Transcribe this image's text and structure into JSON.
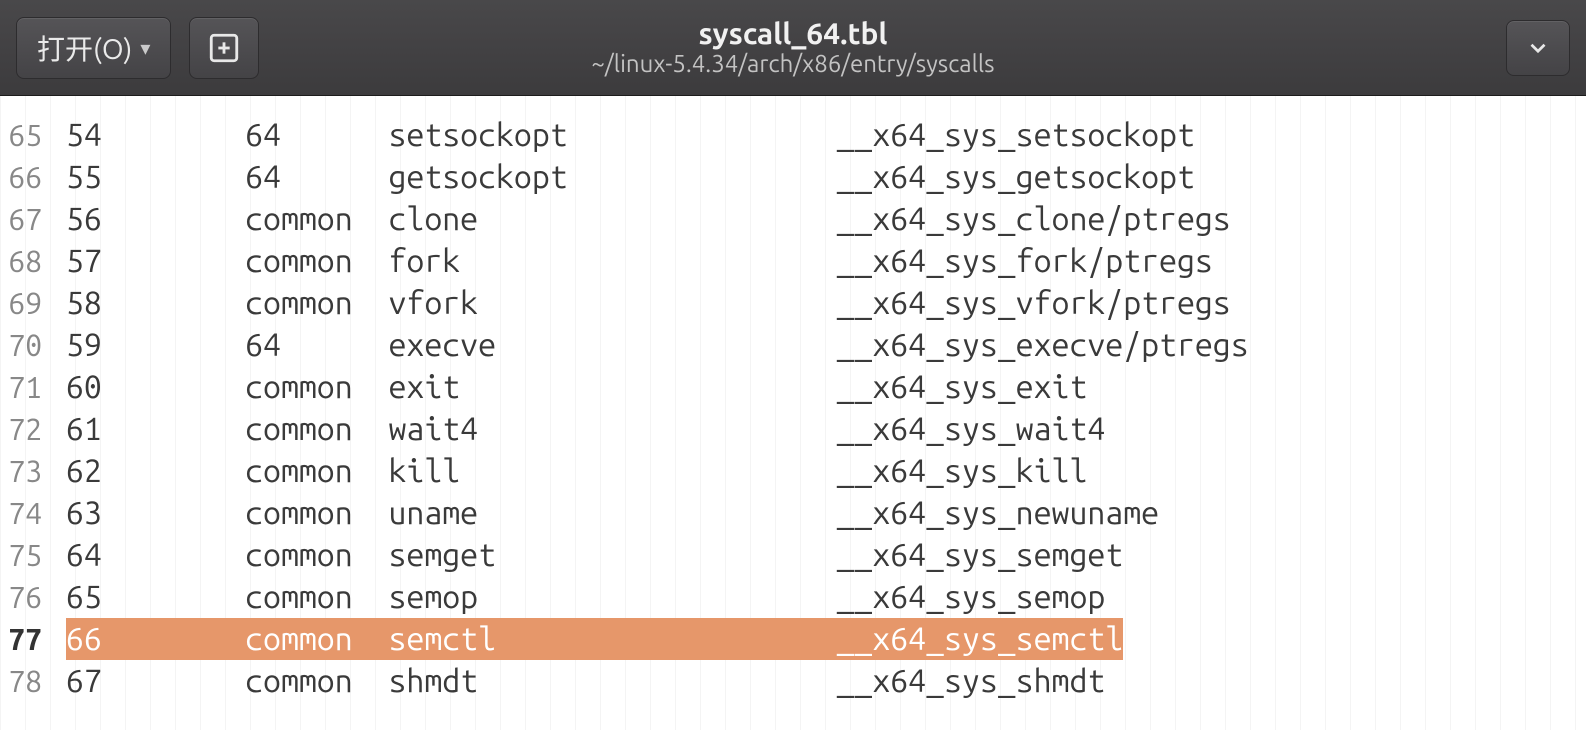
{
  "header": {
    "open_label": "打开(O)",
    "file_title": "syscall_64.tbl",
    "file_path": "~/linux-5.4.34/arch/x86/entry/syscalls"
  },
  "editor": {
    "current_line_index": 12,
    "rows": [
      {
        "lineno": "65",
        "num": "54",
        "abi": "64",
        "name": "setsockopt",
        "entry": "__x64_sys_setsockopt"
      },
      {
        "lineno": "66",
        "num": "55",
        "abi": "64",
        "name": "getsockopt",
        "entry": "__x64_sys_getsockopt"
      },
      {
        "lineno": "67",
        "num": "56",
        "abi": "common",
        "name": "clone",
        "entry": "__x64_sys_clone/ptregs"
      },
      {
        "lineno": "68",
        "num": "57",
        "abi": "common",
        "name": "fork",
        "entry": "__x64_sys_fork/ptregs"
      },
      {
        "lineno": "69",
        "num": "58",
        "abi": "common",
        "name": "vfork",
        "entry": "__x64_sys_vfork/ptregs"
      },
      {
        "lineno": "70",
        "num": "59",
        "abi": "64",
        "name": "execve",
        "entry": "__x64_sys_execve/ptregs"
      },
      {
        "lineno": "71",
        "num": "60",
        "abi": "common",
        "name": "exit",
        "entry": "__x64_sys_exit"
      },
      {
        "lineno": "72",
        "num": "61",
        "abi": "common",
        "name": "wait4",
        "entry": "__x64_sys_wait4"
      },
      {
        "lineno": "73",
        "num": "62",
        "abi": "common",
        "name": "kill",
        "entry": "__x64_sys_kill"
      },
      {
        "lineno": "74",
        "num": "63",
        "abi": "common",
        "name": "uname",
        "entry": "__x64_sys_newuname"
      },
      {
        "lineno": "75",
        "num": "64",
        "abi": "common",
        "name": "semget",
        "entry": "__x64_sys_semget"
      },
      {
        "lineno": "76",
        "num": "65",
        "abi": "common",
        "name": "semop",
        "entry": "__x64_sys_semop"
      },
      {
        "lineno": "77",
        "num": "66",
        "abi": "common",
        "name": "semctl",
        "entry": "__x64_sys_semctl"
      },
      {
        "lineno": "78",
        "num": "67",
        "abi": "common",
        "name": "shmdt",
        "entry": "__x64_sys_shmdt"
      }
    ]
  }
}
